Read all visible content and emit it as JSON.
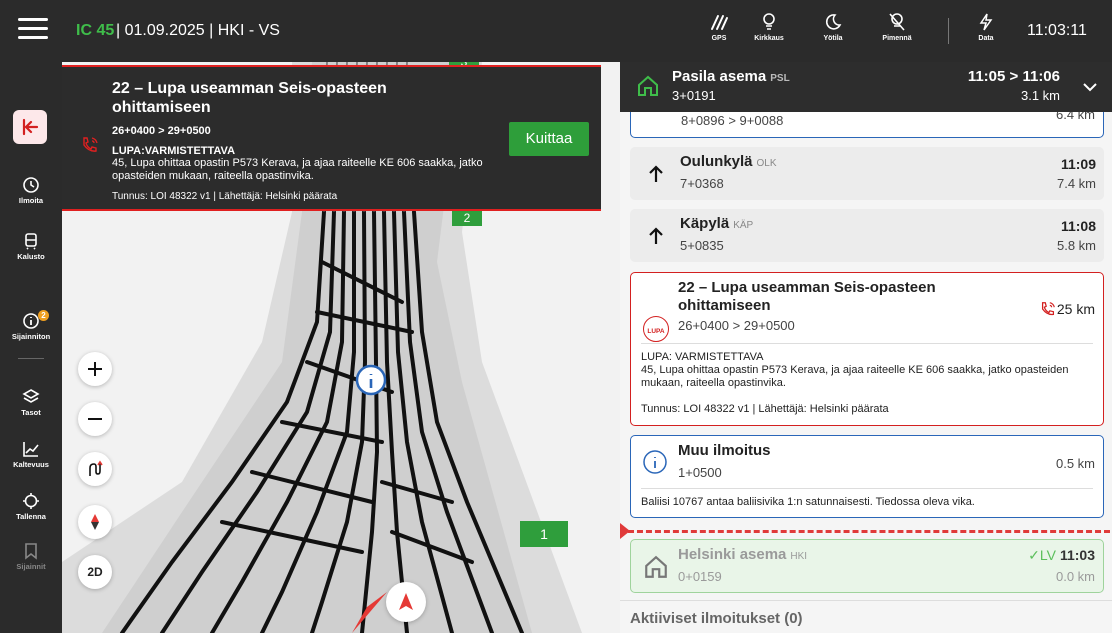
{
  "topbar": {
    "train_id": "IC 45",
    "train_info": "| 01.09.2025 | HKI - VS",
    "items": [
      {
        "label": "GPS",
        "icon": "gps-icon"
      },
      {
        "label": "Kirkkaus",
        "icon": "brightness-icon"
      },
      {
        "label": "Yötila",
        "icon": "night-mode-icon"
      },
      {
        "label": "Pimennä",
        "icon": "dim-icon"
      },
      {
        "label": "Data",
        "icon": "data-icon"
      }
    ],
    "clock": "11:03:11"
  },
  "rail": {
    "items": [
      {
        "label": "Ilmoita",
        "icon": "history-icon"
      },
      {
        "label": "Kalusto",
        "icon": "train-icon"
      },
      {
        "label": "Sijainniton",
        "icon": "info-icon",
        "badge": "2"
      },
      {
        "label": "Tasot",
        "icon": "layers-icon"
      },
      {
        "label": "Kaltevuus",
        "icon": "slope-icon"
      },
      {
        "label": "Tallenna",
        "icon": "crosshair-icon"
      },
      {
        "label": "Sijainnit",
        "icon": "bookmark-icon"
      }
    ]
  },
  "map": {
    "tags": [
      "3",
      "2",
      "1"
    ],
    "mode_label": "2D"
  },
  "alert": {
    "title": "22 – Lupa useamman Seis-opasteen ohittamiseen",
    "km": "26+0400 > 29+0500",
    "status": "LUPA:VARMISTETTAVA",
    "description": "45, Lupa ohittaa opastin P573 Kerava, ja ajaa raiteelle KE 606 saakka, jatko opasteiden mukaan, raiteella opastinvika.",
    "meta": "Tunnus: LOI 48322 v1 | Lähettäjä: Helsinki päärata",
    "ack_label": "Kuittaa"
  },
  "panel": {
    "header": {
      "name": "Pasila asema",
      "code": "PSL",
      "km": "3+0191",
      "time": "11:05 > 11:06",
      "dist": "3.1 km"
    },
    "partial": {
      "km": "8+0896 > 9+0088",
      "dist": "6.4 km"
    },
    "stations": [
      {
        "name": "Oulunkylä",
        "code": "OLK",
        "km": "7+0368",
        "time": "11:09",
        "dist": "7.4 km"
      },
      {
        "name": "Käpylä",
        "code": "KÄP",
        "km": "5+0835",
        "time": "11:08",
        "dist": "5.8 km"
      }
    ],
    "lupa": {
      "badge": "LUPA",
      "title": "22 – Lupa useamman Seis-opasteen ohittamiseen",
      "km": "26+0400 > 29+0500",
      "dist": "25 km",
      "status": "LUPA: VARMISTETTAVA",
      "description": "45, Lupa ohittaa opastin P573 Kerava, ja ajaa raiteelle KE 606 saakka, jatko opasteiden mukaan, raiteella opastinvika.",
      "meta": "Tunnus: LOI 48322 v1 | Lähettäjä: Helsinki päärata"
    },
    "info": {
      "title": "Muu ilmoitus",
      "km": "1+0500",
      "dist": "0.5 km",
      "description": "Baliisi 10767 antaa baliisivika 1:n satunnaisesti. Tiedossa oleva vika."
    },
    "done": {
      "name": "Helsinki asema",
      "code": "HKI",
      "km": "0+0159",
      "status": "LV",
      "time": "11:03",
      "dist": "0.0 km"
    },
    "active_label": "Aktiiviset ilmoitukset (0)"
  },
  "colors": {
    "accent_green": "#3fbd4a",
    "alert_red": "#d32020",
    "info_blue": "#2a66b8"
  }
}
